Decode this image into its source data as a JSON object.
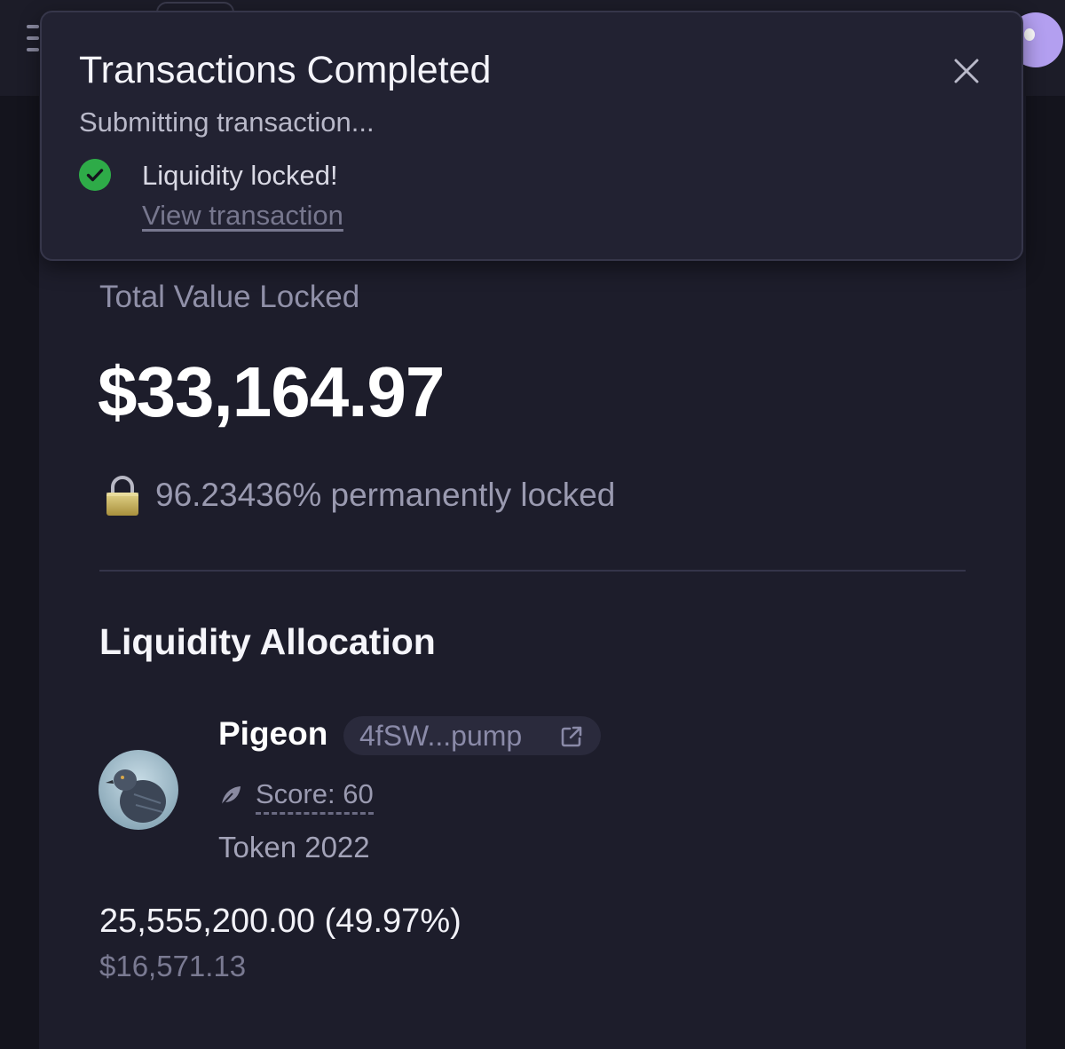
{
  "toast": {
    "title": "Transactions Completed",
    "subtitle": "Submitting transaction...",
    "message": "Liquidity locked!",
    "link_label": "View transaction",
    "close_icon": "close-icon",
    "status_icon": "check-circle-icon"
  },
  "summary": {
    "tvl_label": "Total Value Locked",
    "tvl_value": "$33,164.97",
    "locked_icon": "lock-icon",
    "locked_text": "96.23436% permanently locked"
  },
  "allocation": {
    "title": "Liquidity Allocation",
    "token": {
      "name": "Pigeon",
      "address": "4fSW...pump",
      "address_icon": "external-link-icon",
      "score_icon": "leaf-icon",
      "score_label": "Score: 60",
      "program": "Token 2022",
      "amount": "25,555,200.00 (49.97%)",
      "usd_value": "$16,571.13"
    }
  },
  "colors": {
    "background": "#14141d",
    "card": "#1d1d2b",
    "toast": "#222232",
    "success": "#2eab48",
    "accent": "#b39ff0",
    "muted_text": "#9a9ab0"
  }
}
